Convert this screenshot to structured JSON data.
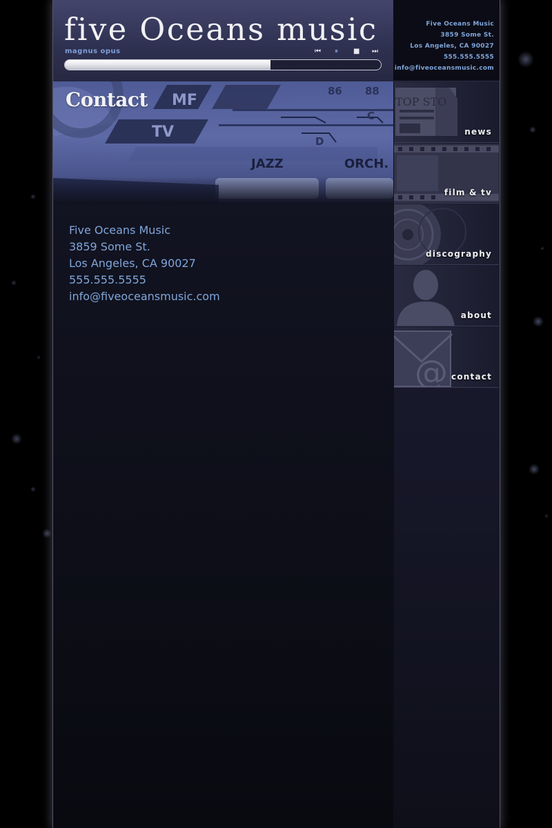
{
  "site": {
    "logo": "five Oceans music",
    "tagline": "magnus opus"
  },
  "player": {
    "prev_icon": "skip-previous-icon",
    "pause_icon": "pause-icon",
    "stop_icon": "stop-icon",
    "next_icon": "skip-next-icon",
    "progress": 0.65
  },
  "sidebar_contact": {
    "name": "Five Oceans Music",
    "street": "3859 Some St.",
    "city": "Los Angeles, CA 90027",
    "phone": "555.555.5555",
    "email": "info@fiveoceansmusic.com"
  },
  "nav": [
    {
      "label": "news",
      "icon": "newspaper-icon"
    },
    {
      "label": "film & tv",
      "icon": "film-strip-icon"
    },
    {
      "label": "discography",
      "icon": "disc-icon"
    },
    {
      "label": "about",
      "icon": "person-silhouette-icon"
    },
    {
      "label": "contact",
      "icon": "envelope-at-icon"
    }
  ],
  "banner": {
    "dial_labels": [
      "MF",
      "TV",
      "86",
      "88",
      "C",
      "D",
      "JAZZ",
      "ORCH."
    ],
    "nav_image_text": "TOP STO"
  },
  "page": {
    "title": "Contact"
  },
  "contact": {
    "name": "Five Oceans Music",
    "street": "3859 Some St.",
    "city": "Los Angeles, CA 90027",
    "phone": "555.555.5555",
    "email": "info@fiveoceansmusic.com"
  },
  "colors": {
    "accent": "#7fa6da",
    "banner": "#5d6aa6",
    "header": "#2e3050"
  }
}
